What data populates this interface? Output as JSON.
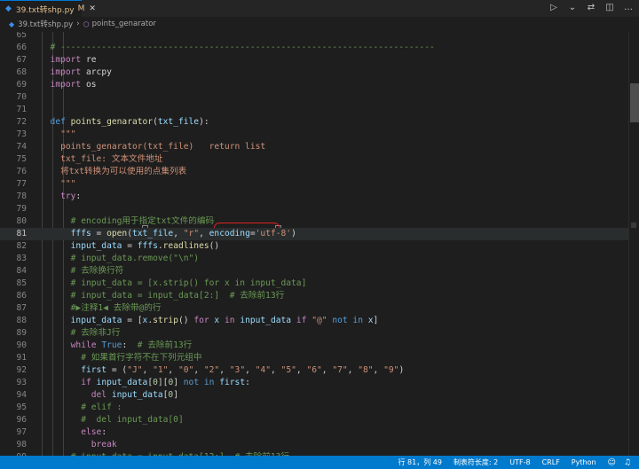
{
  "tab": {
    "label": "39.txt转shp.py",
    "modified": "M"
  },
  "breadcrumb": {
    "file": "39.txt转shp.py",
    "symbol": "points_genarator",
    "separator": "›"
  },
  "lines": [
    {
      "n": "65",
      "tokens": []
    },
    {
      "n": "66",
      "tokens": [
        {
          "c": "cm",
          "t": "  # -------------------------------------------------------------------------"
        }
      ]
    },
    {
      "n": "67",
      "tokens": [
        {
          "c": "kw",
          "t": "  import"
        },
        {
          "c": "txt",
          "t": " re"
        }
      ]
    },
    {
      "n": "68",
      "tokens": [
        {
          "c": "kw",
          "t": "  import"
        },
        {
          "c": "txt",
          "t": " arcpy"
        }
      ]
    },
    {
      "n": "69",
      "tokens": [
        {
          "c": "kw",
          "t": "  import"
        },
        {
          "c": "txt",
          "t": " os"
        }
      ]
    },
    {
      "n": "70",
      "tokens": []
    },
    {
      "n": "71",
      "tokens": []
    },
    {
      "n": "72",
      "tokens": [
        {
          "c": "kb",
          "t": "  def"
        },
        {
          "c": "txt",
          "t": " "
        },
        {
          "c": "fn",
          "t": "points_genarator"
        },
        {
          "c": "txt",
          "t": "("
        },
        {
          "c": "var",
          "t": "txt_file"
        },
        {
          "c": "txt",
          "t": "):"
        }
      ]
    },
    {
      "n": "73",
      "tokens": [
        {
          "c": "doc",
          "t": "    \"\"\""
        }
      ]
    },
    {
      "n": "74",
      "tokens": [
        {
          "c": "doc",
          "t": "    points_genarator(txt_file)   return list"
        }
      ]
    },
    {
      "n": "75",
      "tokens": [
        {
          "c": "doc",
          "t": "    txt_file: 文本文件地址"
        }
      ]
    },
    {
      "n": "76",
      "tokens": [
        {
          "c": "doc",
          "t": "    将txt转换为可以使用的点集列表"
        }
      ]
    },
    {
      "n": "77",
      "tokens": [
        {
          "c": "doc",
          "t": "    \"\"\""
        }
      ]
    },
    {
      "n": "78",
      "tokens": [
        {
          "c": "kw",
          "t": "    try"
        },
        {
          "c": "txt",
          "t": ":"
        }
      ]
    },
    {
      "n": "79",
      "tokens": []
    },
    {
      "n": "80",
      "tokens": [
        {
          "c": "cm",
          "t": "      # encoding用于指定txt文件的编码"
        }
      ]
    },
    {
      "n": "81",
      "tokens": [
        {
          "c": "var",
          "t": "      fffs"
        },
        {
          "c": "txt",
          "t": " = "
        },
        {
          "c": "fn",
          "t": "open"
        },
        {
          "c": "txt",
          "t": "("
        },
        {
          "c": "var",
          "t": "txt_file"
        },
        {
          "c": "txt",
          "t": ", "
        },
        {
          "c": "str",
          "t": "\"r\""
        },
        {
          "c": "txt",
          "t": ", "
        },
        {
          "c": "var",
          "t": "encoding"
        },
        {
          "c": "txt",
          "t": "="
        },
        {
          "c": "str",
          "t": "'utf-8'"
        },
        {
          "c": "txt",
          "t": ")"
        }
      ]
    },
    {
      "n": "82",
      "tokens": [
        {
          "c": "var",
          "t": "      input_data"
        },
        {
          "c": "txt",
          "t": " = "
        },
        {
          "c": "var",
          "t": "fffs"
        },
        {
          "c": "txt",
          "t": "."
        },
        {
          "c": "fn",
          "t": "readlines"
        },
        {
          "c": "txt",
          "t": "()"
        }
      ]
    },
    {
      "n": "83",
      "tokens": [
        {
          "c": "cm",
          "t": "      # input_data.remove(\"\\n\")"
        }
      ]
    },
    {
      "n": "84",
      "tokens": [
        {
          "c": "cm",
          "t": "      # 去除换行符"
        }
      ]
    },
    {
      "n": "85",
      "tokens": [
        {
          "c": "cm",
          "t": "      # input_data = [x.strip() for x in input_data]"
        }
      ]
    },
    {
      "n": "86",
      "tokens": [
        {
          "c": "cm",
          "t": "      # input_data = input_data[2:]  # 去除前13行"
        }
      ]
    },
    {
      "n": "87",
      "tokens": [
        {
          "c": "cm",
          "t": "      #▶注释1◀ 去除带@的行"
        }
      ]
    },
    {
      "n": "88",
      "tokens": [
        {
          "c": "var",
          "t": "      input_data"
        },
        {
          "c": "txt",
          "t": " = ["
        },
        {
          "c": "var",
          "t": "x"
        },
        {
          "c": "txt",
          "t": "."
        },
        {
          "c": "fn",
          "t": "strip"
        },
        {
          "c": "txt",
          "t": "() "
        },
        {
          "c": "kw",
          "t": "for"
        },
        {
          "c": "txt",
          "t": " "
        },
        {
          "c": "var",
          "t": "x"
        },
        {
          "c": "txt",
          "t": " "
        },
        {
          "c": "kw",
          "t": "in"
        },
        {
          "c": "txt",
          "t": " "
        },
        {
          "c": "var",
          "t": "input_data"
        },
        {
          "c": "txt",
          "t": " "
        },
        {
          "c": "kw",
          "t": "if"
        },
        {
          "c": "txt",
          "t": " "
        },
        {
          "c": "str",
          "t": "\"@\""
        },
        {
          "c": "txt",
          "t": " "
        },
        {
          "c": "kb",
          "t": "not in"
        },
        {
          "c": "txt",
          "t": " "
        },
        {
          "c": "var",
          "t": "x"
        },
        {
          "c": "txt",
          "t": "]"
        }
      ]
    },
    {
      "n": "89",
      "tokens": [
        {
          "c": "cm",
          "t": "      # 去除非J行"
        }
      ]
    },
    {
      "n": "90",
      "tokens": [
        {
          "c": "kw",
          "t": "      while"
        },
        {
          "c": "txt",
          "t": " "
        },
        {
          "c": "kb",
          "t": "True"
        },
        {
          "c": "txt",
          "t": ":  "
        },
        {
          "c": "cm",
          "t": "# 去除前13行"
        }
      ]
    },
    {
      "n": "91",
      "tokens": [
        {
          "c": "cm",
          "t": "        # 如果首行字符不在下列元组中"
        }
      ]
    },
    {
      "n": "92",
      "tokens": [
        {
          "c": "var",
          "t": "        first"
        },
        {
          "c": "txt",
          "t": " = ("
        },
        {
          "c": "str",
          "t": "\"J\""
        },
        {
          "c": "txt",
          "t": ", "
        },
        {
          "c": "str",
          "t": "\"1\""
        },
        {
          "c": "txt",
          "t": ", "
        },
        {
          "c": "str",
          "t": "\"0\""
        },
        {
          "c": "txt",
          "t": ", "
        },
        {
          "c": "str",
          "t": "\"2\""
        },
        {
          "c": "txt",
          "t": ", "
        },
        {
          "c": "str",
          "t": "\"3\""
        },
        {
          "c": "txt",
          "t": ", "
        },
        {
          "c": "str",
          "t": "\"4\""
        },
        {
          "c": "txt",
          "t": ", "
        },
        {
          "c": "str",
          "t": "\"5\""
        },
        {
          "c": "txt",
          "t": ", "
        },
        {
          "c": "str",
          "t": "\"6\""
        },
        {
          "c": "txt",
          "t": ", "
        },
        {
          "c": "str",
          "t": "\"7\""
        },
        {
          "c": "txt",
          "t": ", "
        },
        {
          "c": "str",
          "t": "\"8\""
        },
        {
          "c": "txt",
          "t": ", "
        },
        {
          "c": "str",
          "t": "\"9\""
        },
        {
          "c": "txt",
          "t": ")"
        }
      ]
    },
    {
      "n": "93",
      "tokens": [
        {
          "c": "kw",
          "t": "        if"
        },
        {
          "c": "txt",
          "t": " "
        },
        {
          "c": "var",
          "t": "input_data"
        },
        {
          "c": "txt",
          "t": "["
        },
        {
          "c": "num",
          "t": "0"
        },
        {
          "c": "txt",
          "t": "]["
        },
        {
          "c": "num",
          "t": "0"
        },
        {
          "c": "txt",
          "t": "] "
        },
        {
          "c": "kb",
          "t": "not in"
        },
        {
          "c": "txt",
          "t": " "
        },
        {
          "c": "var",
          "t": "first"
        },
        {
          "c": "txt",
          "t": ":"
        }
      ]
    },
    {
      "n": "94",
      "tokens": [
        {
          "c": "kw",
          "t": "          del"
        },
        {
          "c": "txt",
          "t": " "
        },
        {
          "c": "var",
          "t": "input_data"
        },
        {
          "c": "txt",
          "t": "["
        },
        {
          "c": "num",
          "t": "0"
        },
        {
          "c": "txt",
          "t": "]"
        }
      ]
    },
    {
      "n": "95",
      "tokens": [
        {
          "c": "cm",
          "t": "        # elif :"
        }
      ]
    },
    {
      "n": "96",
      "tokens": [
        {
          "c": "cm",
          "t": "        #  del input_data[0]"
        }
      ]
    },
    {
      "n": "97",
      "tokens": [
        {
          "c": "kw",
          "t": "        else"
        },
        {
          "c": "txt",
          "t": ":"
        }
      ]
    },
    {
      "n": "98",
      "tokens": [
        {
          "c": "kw",
          "t": "          break"
        }
      ]
    },
    {
      "n": "99",
      "tokens": [
        {
          "c": "cm",
          "t": "      # input_data = input_data[12:]  # 去除前13行"
        }
      ]
    }
  ],
  "current_line": "81",
  "status": {
    "position": "行 81，列 49",
    "indent": "制表符长度: 2",
    "encoding": "UTF-8",
    "eol": "CRLF",
    "language": "Python"
  }
}
